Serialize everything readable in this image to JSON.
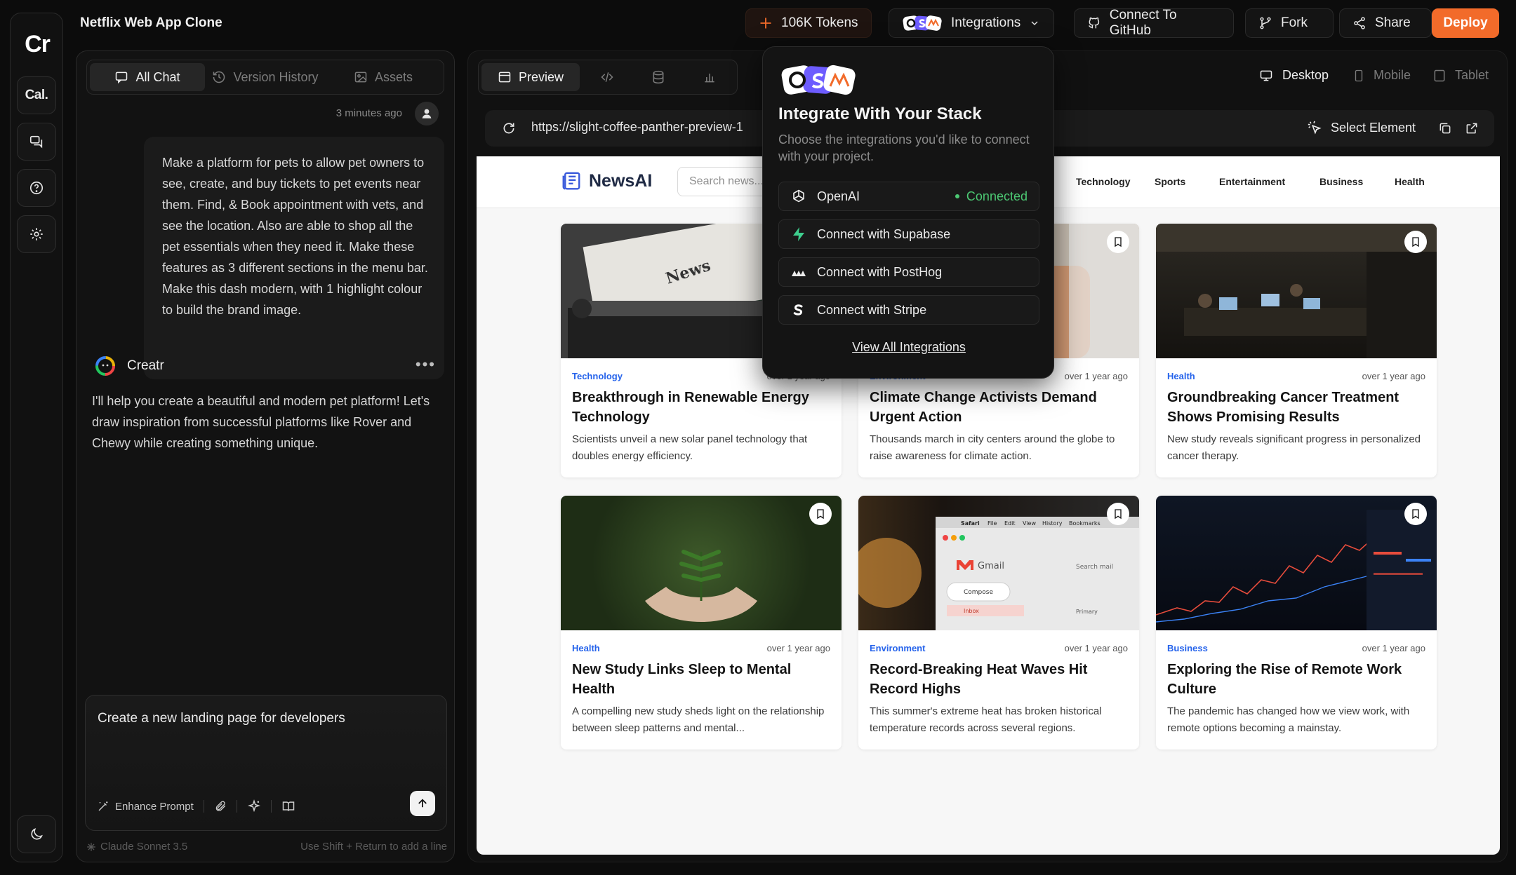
{
  "app": {
    "rail_logo": "Cr",
    "rail_cal": "Cal.",
    "project_title": "Netflix Web App Clone"
  },
  "topbar": {
    "tokens": "106K Tokens",
    "integrations": "Integrations",
    "github": "Connect To GitHub",
    "fork": "Fork",
    "share": "Share",
    "deploy": "Deploy"
  },
  "chat": {
    "tabs": [
      "All Chat",
      "Version History",
      "Assets"
    ],
    "user_time": "3 minutes ago",
    "user_message": "Make a platform for pets to allow pet owners to see, create, and buy tickets to pet events near them. Find, & Book appointment with vets, and see the location. Also are able to shop all the pet essentials when they need it. Make these features as 3 different sections in the menu bar. Make this dash modern, with 1 highlight colour to build the brand image.",
    "bot_name": "Creatr",
    "bot_message": "I'll help you create a beautiful and modern pet platform! Let's draw inspiration from successful platforms like Rover and Chewy while creating something unique.",
    "composer_text": "Create a new landing page for developers",
    "enhance": "Enhance Prompt",
    "model": "Claude Sonnet 3.5",
    "hint": "Use Shift + Return to add a line"
  },
  "preview": {
    "tab_preview": "Preview",
    "devices": [
      "Desktop",
      "Mobile",
      "Tablet"
    ],
    "url": "https://slight-coffee-panther-preview-1",
    "select_element": "Select Element"
  },
  "site": {
    "brand": "NewsAI",
    "search_placeholder": "Search news...",
    "nav": [
      "Technology",
      "Sports",
      "Entertainment",
      "Business",
      "Health"
    ],
    "cards": [
      {
        "category": "Technology",
        "age": "over 1 year ago",
        "title": "Breakthrough in Renewable Energy Technology",
        "desc": "Scientists unveil a new solar panel technology that doubles energy efficiency."
      },
      {
        "category": "Environment",
        "age": "over 1 year ago",
        "title": "Climate Change Activists Demand Urgent Action",
        "desc": "Thousands march in city centers around the globe to raise awareness for climate action."
      },
      {
        "category": "Health",
        "age": "over 1 year ago",
        "title": "Groundbreaking Cancer Treatment Shows Promising Results",
        "desc": "New study reveals significant progress in personalized cancer therapy."
      },
      {
        "category": "Health",
        "age": "over 1 year ago",
        "title": "New Study Links Sleep to Mental Health",
        "desc": "A compelling new study sheds light on the relationship between sleep patterns and mental..."
      },
      {
        "category": "Environment",
        "age": "over 1 year ago",
        "title": "Record-Breaking Heat Waves Hit Record Highs",
        "desc": "This summer's extreme heat has broken historical temperature records across several regions."
      },
      {
        "category": "Business",
        "age": "over 1 year ago",
        "title": "Exploring the Rise of Remote Work Culture",
        "desc": "The pandemic has changed how we view work, with remote options becoming a mainstay."
      }
    ],
    "image_text": {
      "typewriter": "News",
      "gmail": "Gmail",
      "search_mail": "Search mail",
      "compose": "Compose",
      "inbox": "Inbox",
      "primary": "Primary",
      "menu_safari": "Safari",
      "menu_file": "File",
      "menu_edit": "Edit",
      "menu_view": "View",
      "menu_history": "History",
      "menu_bookmarks": "Bookmarks"
    }
  },
  "popup": {
    "title": "Integrate With Your Stack",
    "subtitle": "Choose the integrations you'd like to connect with your project.",
    "openai": "OpenAI",
    "connected": "Connected",
    "supabase": "Connect with Supabase",
    "posthog": "Connect with PostHog",
    "stripe": "Connect with Stripe",
    "view_all": "View All Integrations"
  },
  "colors": {
    "accent": "#f26b2a",
    "connected": "#4cc873",
    "category": "#2563eb"
  }
}
